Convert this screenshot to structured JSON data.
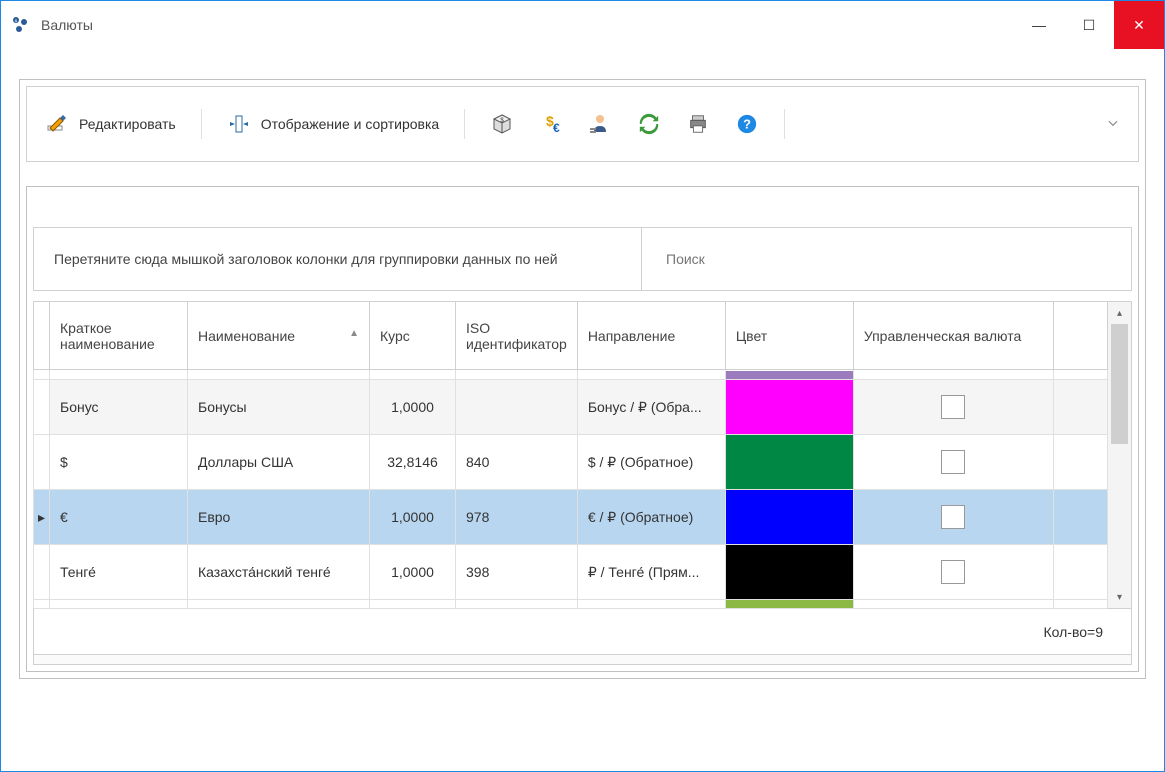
{
  "window": {
    "title": "Валюты",
    "minimize_icon": "—",
    "maximize_icon": "☐",
    "close_icon": "✕"
  },
  "toolbar": {
    "edit_label": "Редактировать",
    "view_sort_label": "Отображение и сортировка",
    "cube_icon": "cube",
    "currency_icon": "dollar-euro",
    "person_icon": "manager",
    "refresh_icon": "refresh",
    "print_icon": "print",
    "help_icon": "help",
    "expand_icon": "chevron-down"
  },
  "grid": {
    "group_hint": "Перетяните сюда мышкой заголовок колонки для группировки данных по ней",
    "search_placeholder": "Поиск",
    "columns": {
      "short_name": "Краткое наименование",
      "name": "Наименование",
      "rate": "Курс",
      "iso": "ISO идентификатор",
      "direction": "Направление",
      "color": "Цвет",
      "mgmt": "Управленческая валюта"
    },
    "sort_column": "name",
    "sort_dir": "asc",
    "rows": [
      {
        "short": "",
        "name": "",
        "rate": "",
        "iso": "",
        "direction": "",
        "color": "#9b7bbd",
        "mgmt": false,
        "sliver": true
      },
      {
        "short": "Бонус",
        "name": "Бонусы",
        "rate": "1,0000",
        "iso": "",
        "direction": "Бонус / ₽   (Обра...",
        "color": "#ff00ff",
        "mgmt": false,
        "alt": true
      },
      {
        "short": "$",
        "name": "Доллары США",
        "rate": "32,8146",
        "iso": "840",
        "direction": "$ / ₽   (Обратное)",
        "color": "#008744",
        "mgmt": false
      },
      {
        "short": "€",
        "name": "Евро",
        "rate": "1,0000",
        "iso": "978",
        "direction": "€ / ₽   (Обратное)",
        "color": "#0000ff",
        "mgmt": false,
        "selected": true
      },
      {
        "short": "Тенге́",
        "name": "Казахста́нский тенге́",
        "rate": "1,0000",
        "iso": "398",
        "direction": "₽ / Тенге́   (Прям...",
        "color": "#000000",
        "mgmt": false
      },
      {
        "short": "",
        "name": "",
        "rate": "",
        "iso": "",
        "direction": "",
        "color": "#8bb943",
        "mgmt": false,
        "bottom_sliver": true
      }
    ],
    "footer_count": "Кол-во=9"
  }
}
